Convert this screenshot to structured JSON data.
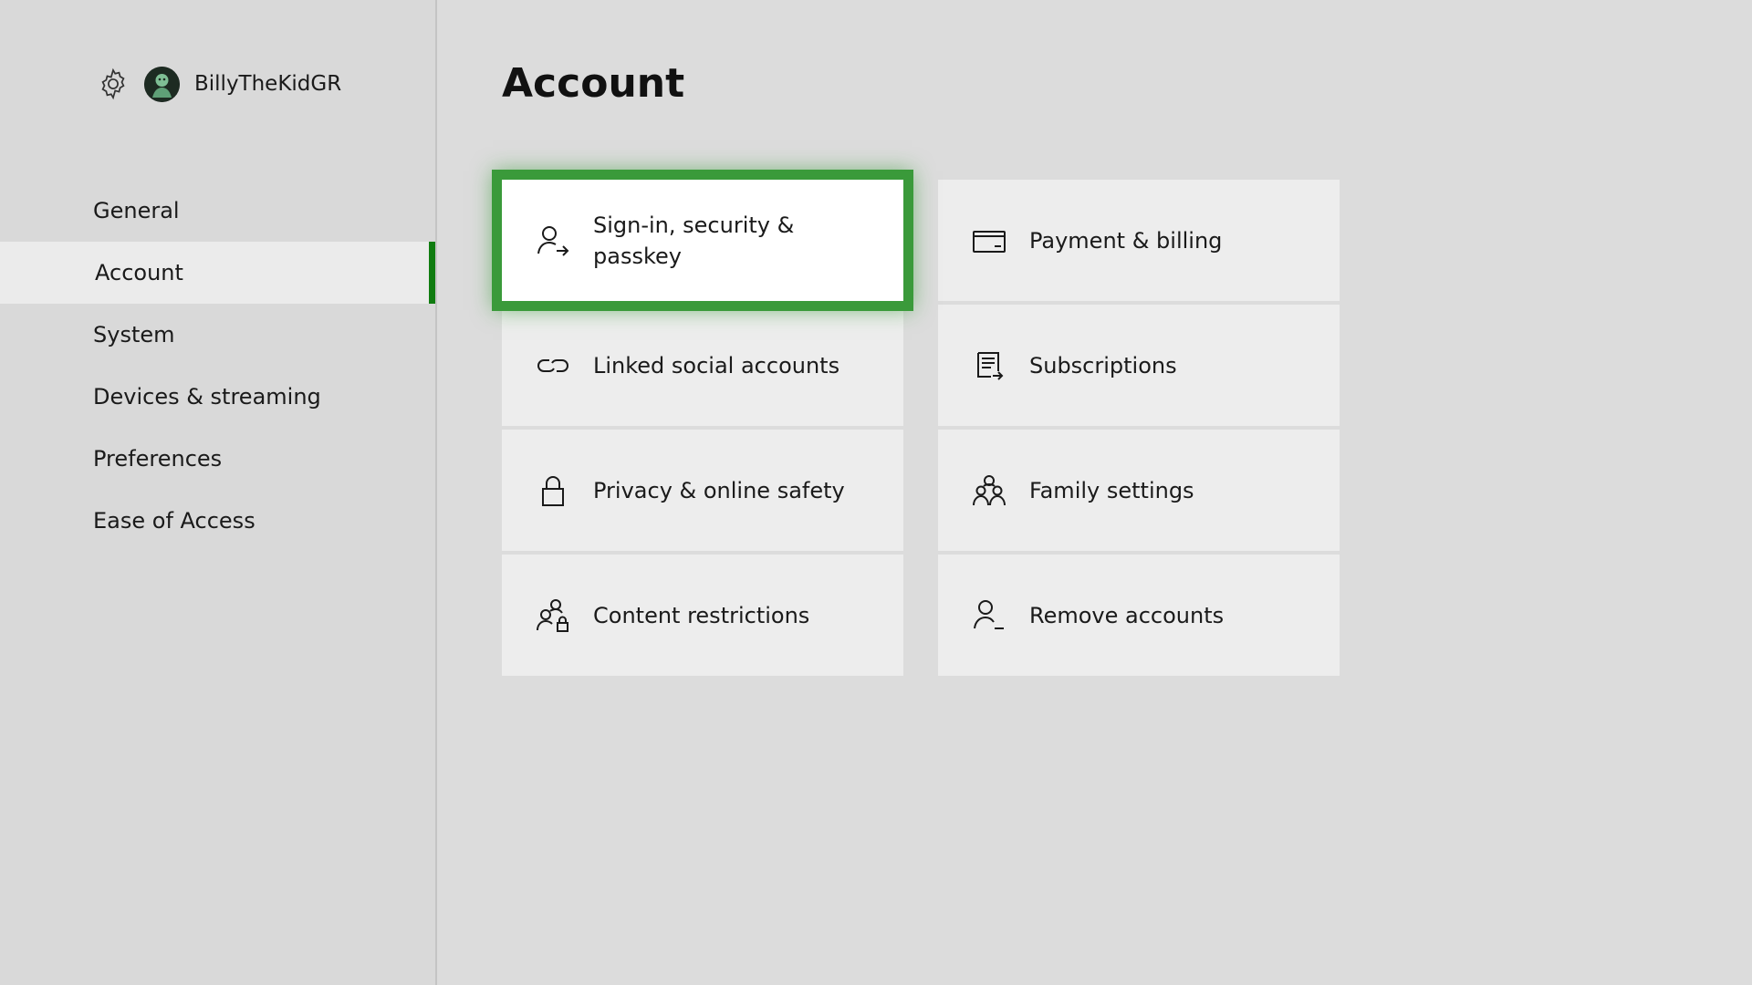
{
  "profile": {
    "username": "BillyTheKidGR"
  },
  "nav": {
    "items": [
      {
        "label": "General"
      },
      {
        "label": "Account",
        "selected": true
      },
      {
        "label": "System"
      },
      {
        "label": "Devices & streaming"
      },
      {
        "label": "Preferences"
      },
      {
        "label": "Ease of Access"
      }
    ]
  },
  "page": {
    "title": "Account"
  },
  "tiles": [
    {
      "label": "Sign-in, security & passkey",
      "icon": "person-arrow-icon",
      "focused": true
    },
    {
      "label": "Payment & billing",
      "icon": "credit-card-icon"
    },
    {
      "label": "Linked social accounts",
      "icon": "link-icon"
    },
    {
      "label": "Subscriptions",
      "icon": "subscriptions-icon"
    },
    {
      "label": "Privacy & online safety",
      "icon": "lock-icon"
    },
    {
      "label": "Family settings",
      "icon": "family-icon"
    },
    {
      "label": "Content restrictions",
      "icon": "people-lock-icon"
    },
    {
      "label": "Remove accounts",
      "icon": "person-remove-icon"
    }
  ],
  "colors": {
    "accent": "#107c10",
    "focus": "#3a9a3a",
    "background": "#dcdcdc",
    "tile": "#ededed"
  }
}
